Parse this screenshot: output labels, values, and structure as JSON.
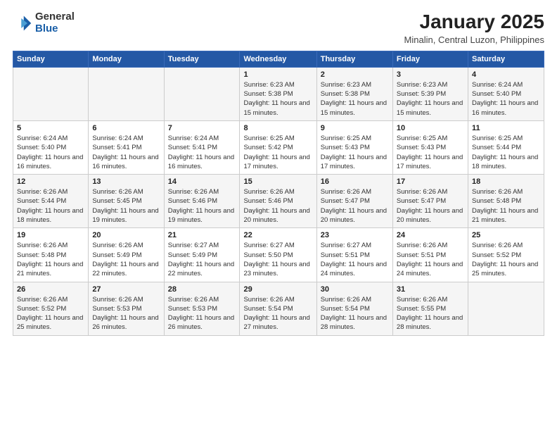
{
  "logo": {
    "general": "General",
    "blue": "Blue"
  },
  "header": {
    "month": "January 2025",
    "location": "Minalin, Central Luzon, Philippines"
  },
  "weekdays": [
    "Sunday",
    "Monday",
    "Tuesday",
    "Wednesday",
    "Thursday",
    "Friday",
    "Saturday"
  ],
  "weeks": [
    [
      {
        "day": "",
        "info": ""
      },
      {
        "day": "",
        "info": ""
      },
      {
        "day": "",
        "info": ""
      },
      {
        "day": "1",
        "info": "Sunrise: 6:23 AM\nSunset: 5:38 PM\nDaylight: 11 hours and 15 minutes."
      },
      {
        "day": "2",
        "info": "Sunrise: 6:23 AM\nSunset: 5:38 PM\nDaylight: 11 hours and 15 minutes."
      },
      {
        "day": "3",
        "info": "Sunrise: 6:23 AM\nSunset: 5:39 PM\nDaylight: 11 hours and 15 minutes."
      },
      {
        "day": "4",
        "info": "Sunrise: 6:24 AM\nSunset: 5:40 PM\nDaylight: 11 hours and 16 minutes."
      }
    ],
    [
      {
        "day": "5",
        "info": "Sunrise: 6:24 AM\nSunset: 5:40 PM\nDaylight: 11 hours and 16 minutes."
      },
      {
        "day": "6",
        "info": "Sunrise: 6:24 AM\nSunset: 5:41 PM\nDaylight: 11 hours and 16 minutes."
      },
      {
        "day": "7",
        "info": "Sunrise: 6:24 AM\nSunset: 5:41 PM\nDaylight: 11 hours and 16 minutes."
      },
      {
        "day": "8",
        "info": "Sunrise: 6:25 AM\nSunset: 5:42 PM\nDaylight: 11 hours and 17 minutes."
      },
      {
        "day": "9",
        "info": "Sunrise: 6:25 AM\nSunset: 5:43 PM\nDaylight: 11 hours and 17 minutes."
      },
      {
        "day": "10",
        "info": "Sunrise: 6:25 AM\nSunset: 5:43 PM\nDaylight: 11 hours and 17 minutes."
      },
      {
        "day": "11",
        "info": "Sunrise: 6:25 AM\nSunset: 5:44 PM\nDaylight: 11 hours and 18 minutes."
      }
    ],
    [
      {
        "day": "12",
        "info": "Sunrise: 6:26 AM\nSunset: 5:44 PM\nDaylight: 11 hours and 18 minutes."
      },
      {
        "day": "13",
        "info": "Sunrise: 6:26 AM\nSunset: 5:45 PM\nDaylight: 11 hours and 19 minutes."
      },
      {
        "day": "14",
        "info": "Sunrise: 6:26 AM\nSunset: 5:46 PM\nDaylight: 11 hours and 19 minutes."
      },
      {
        "day": "15",
        "info": "Sunrise: 6:26 AM\nSunset: 5:46 PM\nDaylight: 11 hours and 20 minutes."
      },
      {
        "day": "16",
        "info": "Sunrise: 6:26 AM\nSunset: 5:47 PM\nDaylight: 11 hours and 20 minutes."
      },
      {
        "day": "17",
        "info": "Sunrise: 6:26 AM\nSunset: 5:47 PM\nDaylight: 11 hours and 20 minutes."
      },
      {
        "day": "18",
        "info": "Sunrise: 6:26 AM\nSunset: 5:48 PM\nDaylight: 11 hours and 21 minutes."
      }
    ],
    [
      {
        "day": "19",
        "info": "Sunrise: 6:26 AM\nSunset: 5:48 PM\nDaylight: 11 hours and 21 minutes."
      },
      {
        "day": "20",
        "info": "Sunrise: 6:26 AM\nSunset: 5:49 PM\nDaylight: 11 hours and 22 minutes."
      },
      {
        "day": "21",
        "info": "Sunrise: 6:27 AM\nSunset: 5:49 PM\nDaylight: 11 hours and 22 minutes."
      },
      {
        "day": "22",
        "info": "Sunrise: 6:27 AM\nSunset: 5:50 PM\nDaylight: 11 hours and 23 minutes."
      },
      {
        "day": "23",
        "info": "Sunrise: 6:27 AM\nSunset: 5:51 PM\nDaylight: 11 hours and 24 minutes."
      },
      {
        "day": "24",
        "info": "Sunrise: 6:26 AM\nSunset: 5:51 PM\nDaylight: 11 hours and 24 minutes."
      },
      {
        "day": "25",
        "info": "Sunrise: 6:26 AM\nSunset: 5:52 PM\nDaylight: 11 hours and 25 minutes."
      }
    ],
    [
      {
        "day": "26",
        "info": "Sunrise: 6:26 AM\nSunset: 5:52 PM\nDaylight: 11 hours and 25 minutes."
      },
      {
        "day": "27",
        "info": "Sunrise: 6:26 AM\nSunset: 5:53 PM\nDaylight: 11 hours and 26 minutes."
      },
      {
        "day": "28",
        "info": "Sunrise: 6:26 AM\nSunset: 5:53 PM\nDaylight: 11 hours and 26 minutes."
      },
      {
        "day": "29",
        "info": "Sunrise: 6:26 AM\nSunset: 5:54 PM\nDaylight: 11 hours and 27 minutes."
      },
      {
        "day": "30",
        "info": "Sunrise: 6:26 AM\nSunset: 5:54 PM\nDaylight: 11 hours and 28 minutes."
      },
      {
        "day": "31",
        "info": "Sunrise: 6:26 AM\nSunset: 5:55 PM\nDaylight: 11 hours and 28 minutes."
      },
      {
        "day": "",
        "info": ""
      }
    ]
  ]
}
